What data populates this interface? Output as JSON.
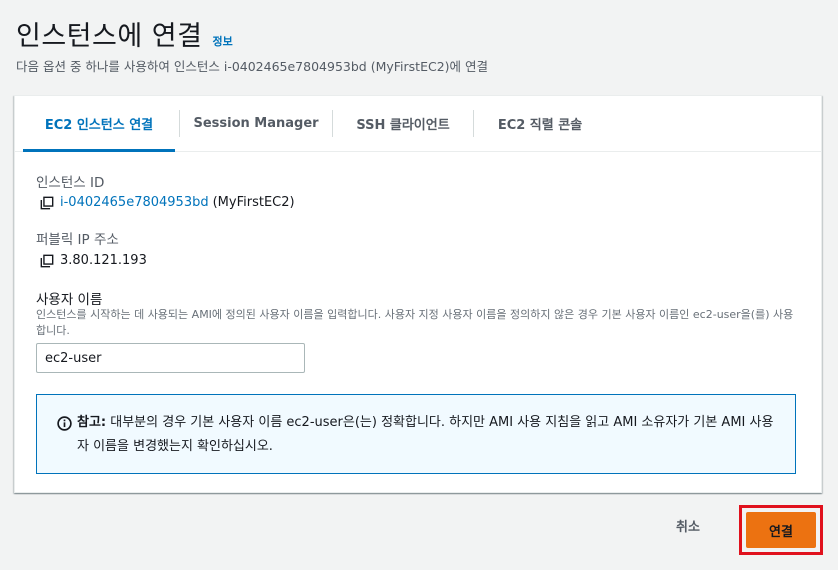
{
  "header": {
    "title": "인스턴스에 연결",
    "info_link": "정보",
    "subtitle": "다음 옵션 중 하나를 사용하여 인스턴스 i-0402465e7804953bd (MyFirstEC2)에 연결"
  },
  "tabs": [
    {
      "label": "EC2 인스턴스 연결",
      "active": true
    },
    {
      "label": "Session Manager",
      "active": false
    },
    {
      "label": "SSH 클라이언트",
      "active": false
    },
    {
      "label": "EC2 직렬 콘솔",
      "active": false
    }
  ],
  "instance": {
    "id_label": "인스턴스 ID",
    "id_value": "i-0402465e7804953bd",
    "name": "(MyFirstEC2)",
    "ip_label": "퍼블릭 IP 주소",
    "ip_value": "3.80.121.193"
  },
  "username": {
    "label": "사용자 이름",
    "description": "인스턴스를 시작하는 데 사용되는 AMI에 정의된 사용자 이름을 입력합니다. 사용자 지정 사용자 이름을 정의하지 않은 경우 기본 사용자 이름인 ec2-user을(를) 사용합니다.",
    "value": "ec2-user"
  },
  "alert": {
    "prefix": "참고:",
    "text": "대부분의 경우 기본 사용자 이름 ec2-user은(는) 정확합니다. 하지만 AMI 사용 지침을 읽고 AMI 소유자가 기본 AMI 사용자 이름을 변경했는지 확인하십시오.",
    "icon": "info-icon"
  },
  "footer": {
    "cancel_label": "취소",
    "connect_label": "연결"
  },
  "colors": {
    "accent": "#0073bb",
    "primary_button": "#ec7211",
    "highlight": "#e0111d"
  }
}
